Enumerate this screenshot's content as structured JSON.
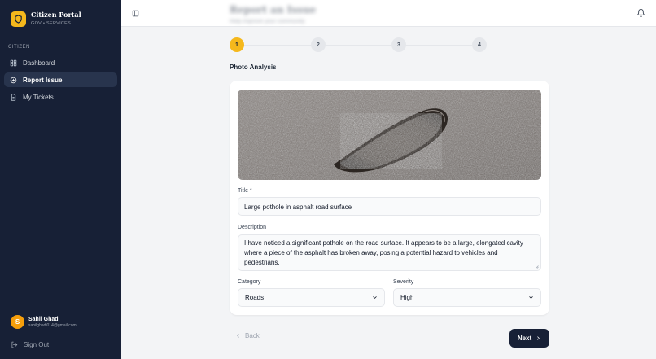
{
  "brand": {
    "title": "Citizen Portal",
    "subtitle": "GOV • SERVICES"
  },
  "sidebar": {
    "section_label": "CITIZEN",
    "items": [
      {
        "label": "Dashboard",
        "icon": "grid-icon",
        "active": false
      },
      {
        "label": "Report Issue",
        "icon": "plus-circle-icon",
        "active": true
      },
      {
        "label": "My Tickets",
        "icon": "file-icon",
        "active": false
      }
    ]
  },
  "user": {
    "initial": "S",
    "name": "Sahil Ghadi",
    "email": "sahilghadi014@gmail.com"
  },
  "signout_label": "Sign Out",
  "header": {
    "title": "Report an Issue",
    "subtitle": "Help improve your community"
  },
  "stepper": {
    "steps": [
      "1",
      "2",
      "3",
      "4"
    ],
    "current": 1
  },
  "section_title": "Photo Analysis",
  "form": {
    "title_label": "Title *",
    "title_value": "Large pothole in asphalt road surface",
    "description_label": "Description",
    "description_value": "I have noticed a significant pothole on the road surface. It appears to be a large, elongated cavity where a piece of the asphalt has broken away, posing a potential hazard to vehicles and pedestrians.",
    "category_label": "Category",
    "category_value": "Roads",
    "severity_label": "Severity",
    "severity_value": "High"
  },
  "buttons": {
    "back": "Back",
    "next": "Next"
  },
  "colors": {
    "sidebar_bg": "#172036",
    "accent": "#f5b81c",
    "page_bg": "#f3f4f6"
  }
}
